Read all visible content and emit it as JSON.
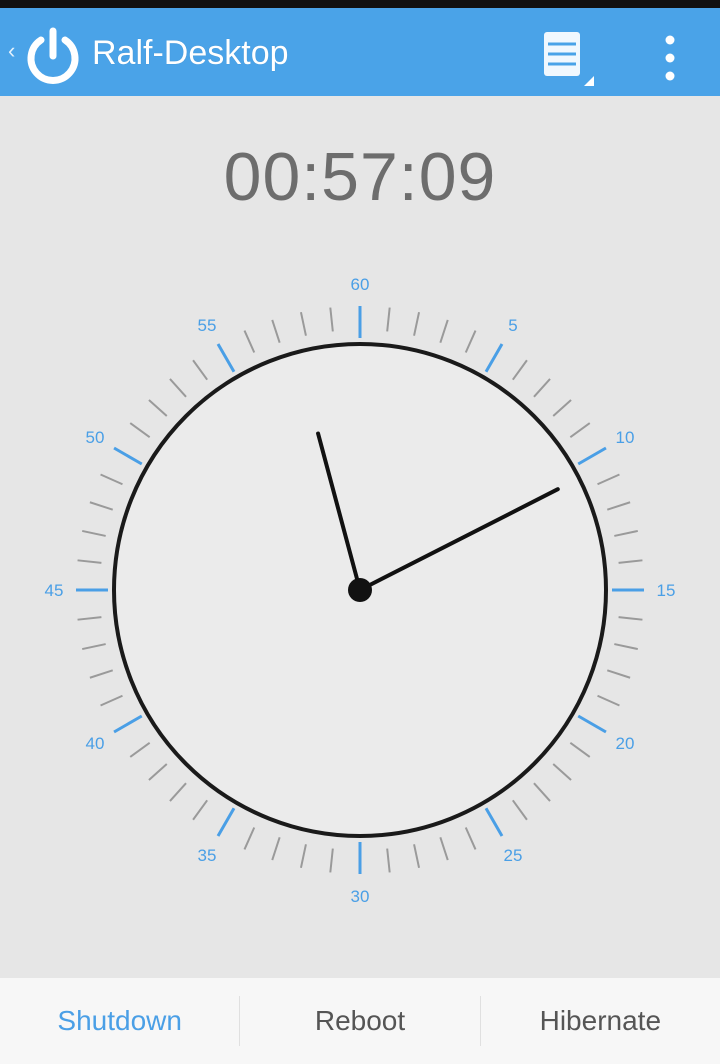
{
  "app": {
    "title": "Ralf-Desktop",
    "accent_color": "#4aa3e8",
    "icons": {
      "back": "chevron-left-icon",
      "app": "power-icon",
      "device": "server-icon",
      "overflow": "more-vert-icon"
    }
  },
  "timer": {
    "value": "00:57:09"
  },
  "dial": {
    "max_minutes": 60,
    "label_color": "#4a9fe6",
    "labels": [
      "60",
      "5",
      "10",
      "15",
      "20",
      "25",
      "30",
      "35",
      "40",
      "45",
      "50",
      "55"
    ],
    "hand_a_minutes": 57.5,
    "hand_b_minutes": 10.5
  },
  "actions": {
    "shutdown": "Shutdown",
    "reboot": "Reboot",
    "hibernate": "Hibernate",
    "selected": "shutdown"
  }
}
